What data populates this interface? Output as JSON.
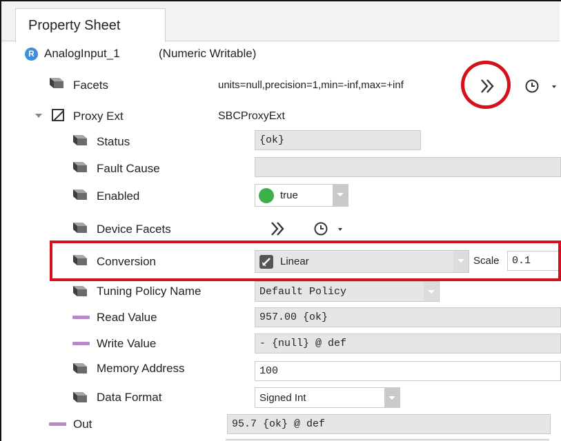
{
  "tab": {
    "title": "Property Sheet"
  },
  "root": {
    "badge": "R",
    "name": "AnalogInput_1",
    "type": "(Numeric Writable)"
  },
  "facets": {
    "label": "Facets",
    "value": "units=null,precision=1,min=-inf,max=+inf"
  },
  "proxy_ext": {
    "label": "Proxy Ext",
    "value": "SBCProxyExt"
  },
  "rows": {
    "status": {
      "label": "Status",
      "value": "{ok}"
    },
    "fault_cause": {
      "label": "Fault Cause",
      "value": ""
    },
    "enabled": {
      "label": "Enabled",
      "value": "true"
    },
    "device_facets": {
      "label": "Device Facets"
    },
    "conversion": {
      "label": "Conversion",
      "value": "Linear",
      "scale_label": "Scale",
      "scale_value": "0.1"
    },
    "tuning_policy": {
      "label": "Tuning Policy Name",
      "value": "Default Policy"
    },
    "read_value": {
      "label": "Read Value",
      "value": "957.00 {ok}"
    },
    "write_value": {
      "label": "Write Value",
      "value": "- {null} @ def"
    },
    "memory_address": {
      "label": "Memory Address",
      "value": "100"
    },
    "data_format": {
      "label": "Data Format",
      "value": "Signed Int"
    }
  },
  "out": {
    "label": "Out",
    "value": "95.7 {ok} @ def"
  },
  "icons": {
    "forward": "double-chevron-right-icon",
    "history": "clock-icon",
    "menu": "caret-down-icon"
  },
  "colors": {
    "highlight": "#d4111b",
    "enabled_dot": "#3db04b",
    "badge": "#3d8fdb",
    "numeric_slot": "#b48ac9"
  }
}
